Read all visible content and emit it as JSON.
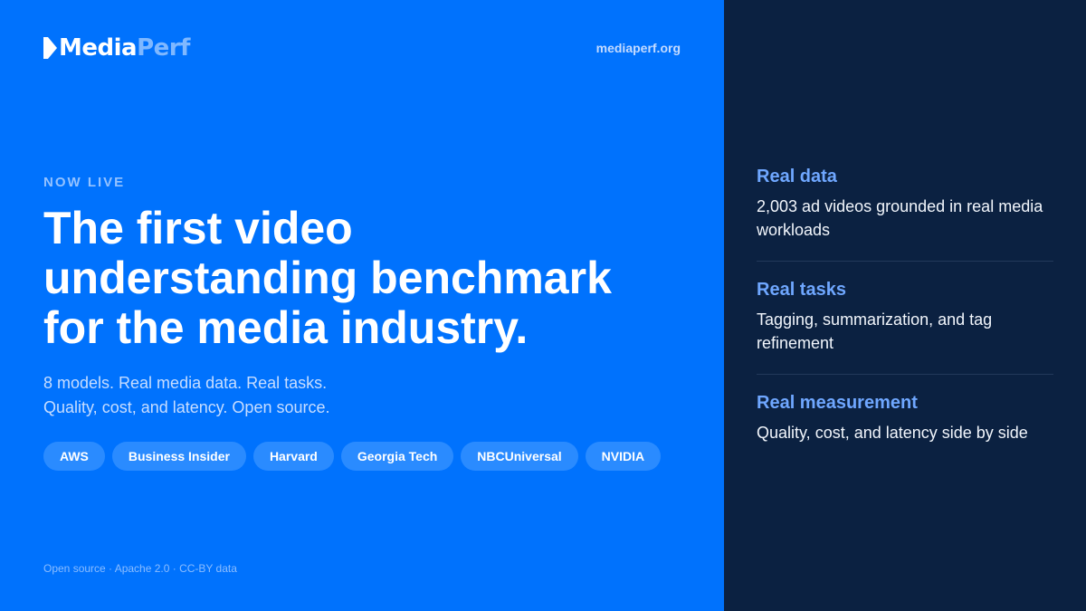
{
  "header": {
    "logo_part1": "Media",
    "logo_part2": "Perf",
    "site_url": "mediaperf.org"
  },
  "hero": {
    "eyebrow": "NOW LIVE",
    "headline_lines": [
      "The first video",
      "understanding benchmark",
      "for the media industry."
    ],
    "subheadline_lines": [
      "8 models. Real media data. Real tasks.",
      "Quality, cost, and latency. Open source."
    ],
    "partners": [
      "AWS",
      "Business Insider",
      "Harvard",
      "Georgia Tech",
      "NBCUniversal",
      "NVIDIA"
    ],
    "footer_note": "Open source · Apache 2.0 · CC-BY data"
  },
  "features": [
    {
      "title": "Real data",
      "description": "2,003 ad videos grounded in real media workloads"
    },
    {
      "title": "Real tasks",
      "description": "Tagging, summarization, and tag refinement"
    },
    {
      "title": "Real measurement",
      "description": "Quality, cost, and latency side by side"
    }
  ],
  "colors": {
    "left_panel": "#0072FD",
    "right_panel": "#0B2141",
    "chip": "#2A8BFF",
    "feature_title": "#6FA7FF"
  }
}
